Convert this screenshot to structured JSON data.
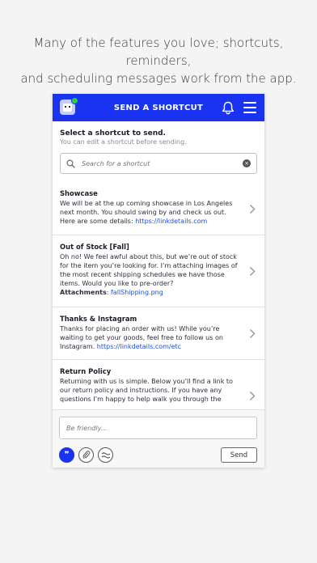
{
  "promo": {
    "line1": "Many of the features you love; shortcuts, reminders,",
    "line2": "and scheduling messages work from the app."
  },
  "topbar": {
    "title": "SEND A SHORTCUT",
    "accent": "#1a33f0",
    "status_dot": "#2ecc40",
    "icons": [
      "app-logo",
      "bell-icon",
      "menu-icon"
    ]
  },
  "header": {
    "heading": "Select a shortcut to send.",
    "subheading": "You can edit a shortcut before sending."
  },
  "search": {
    "placeholder": "Search for a shortcut",
    "value": ""
  },
  "shortcuts": [
    {
      "name": "Showcase",
      "text": "We will be at the up coming showcase in Los Angeles next month. You should swing by and check us out. Here are some details: ",
      "link": "https://linkdetails.com"
    },
    {
      "name": "Out of Stock [Fall]",
      "text": "Oh no! We feel awful about this, but we’re out of stock for the item you’re looking for. I’m attaching images of the most recent shipping schedules we have those items. Would you like to pre-order?",
      "attachment_label": "Attachments",
      "attachment_file": "fallShipping.png"
    },
    {
      "name": "Thanks & Instagram",
      "text": "Thanks for placing an order with us! While you’re waiting to get your goods, feel free to follow us on Instagram. ",
      "link": "https://linkdetails.com/etc"
    },
    {
      "name": "Return Policy",
      "text": "Returning with us is simple. Below you’ll find a link to our return policy and instructions. If you have any questions I’m happy to help walk you through the"
    }
  ],
  "composer": {
    "placeholder": "Be friendly...",
    "value": "",
    "send_label": "Send",
    "tools": [
      "quote-icon",
      "paperclip-icon",
      "wave-icon"
    ]
  }
}
